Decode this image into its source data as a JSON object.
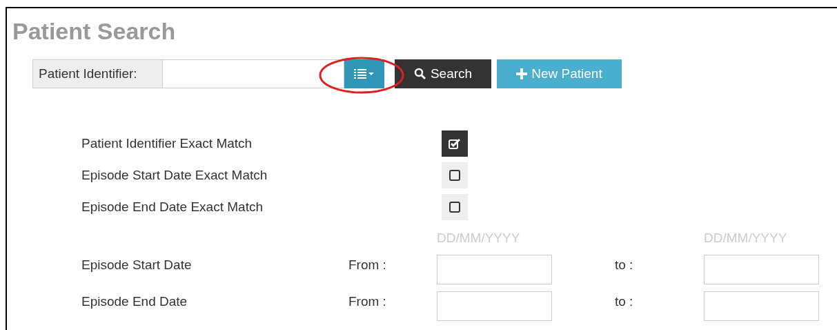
{
  "title": "Patient Search",
  "search_bar": {
    "label": "Patient Identifier:",
    "search_button": "Search",
    "new_button": "New Patient"
  },
  "options": [
    {
      "label": "Patient Identifier Exact Match",
      "checked": true
    },
    {
      "label": "Episode Start Date Exact Match",
      "checked": false
    },
    {
      "label": "Episode End Date Exact Match",
      "checked": false
    }
  ],
  "date_filters": {
    "hints": [
      "DD/MM/YYYY",
      "DD/MM/YYYY"
    ],
    "rows": [
      {
        "label": "Episode Start Date",
        "from_label": "From :",
        "to_label": "to :"
      },
      {
        "label": "Episode End Date",
        "from_label": "From :",
        "to_label": "to :"
      }
    ]
  }
}
